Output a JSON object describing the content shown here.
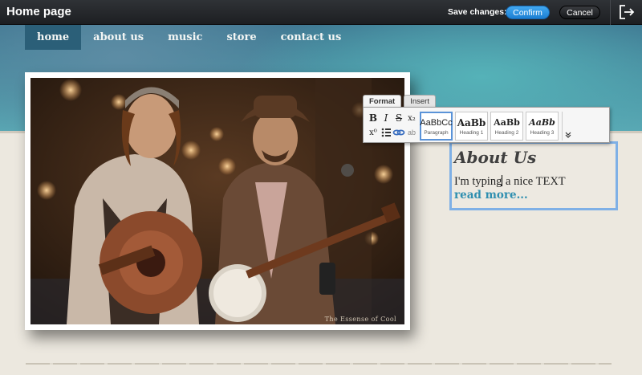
{
  "topbar": {
    "title": "Home page",
    "save_label": "Save changes:",
    "confirm_label": "Confirm",
    "cancel_label": "Cancel"
  },
  "nav": {
    "items": [
      {
        "label": "home",
        "active": true
      },
      {
        "label": "about us"
      },
      {
        "label": "music"
      },
      {
        "label": "store"
      },
      {
        "label": "contact us"
      }
    ]
  },
  "photo": {
    "watermark": "The Essense of Cool"
  },
  "toolbar": {
    "tabs": [
      "Format",
      "Insert"
    ],
    "active_tab": "Format",
    "buttons": {
      "bold": "B",
      "italic": "I",
      "strike": "S",
      "subscript": "x₂",
      "superscript": "x⁰",
      "extra": "ab"
    },
    "styles": [
      {
        "sample": "AaBbCc",
        "name": "Paragraph",
        "selected": true
      },
      {
        "sample": "AaBb",
        "name": "Heading 1"
      },
      {
        "sample": "AaBb",
        "name": "Heading 2"
      },
      {
        "sample": "AaBb",
        "name": "Heading 3"
      }
    ]
  },
  "content": {
    "heading": "About Us",
    "body_before_cursor": "I'm typing",
    "body_after_cursor": " a nice TEXT",
    "read_more": "read more..."
  },
  "colors": {
    "accent": "#1c7fd3",
    "selection_border": "#7fb0e6",
    "nav_active": "#2b5f78",
    "link": "#2f8fb0"
  }
}
